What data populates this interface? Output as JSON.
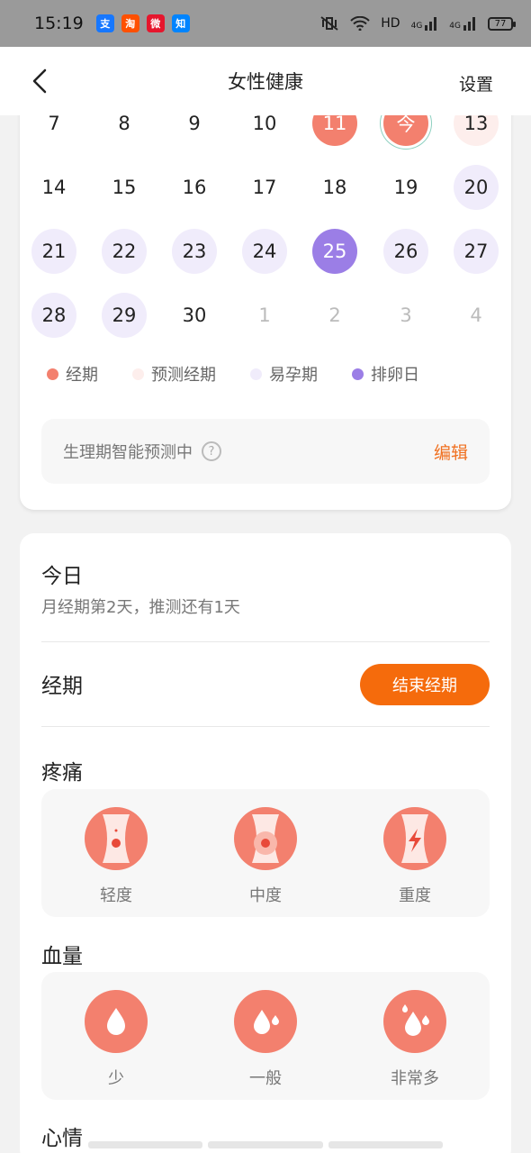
{
  "status": {
    "time": "15:19",
    "apps": [
      {
        "name": "alipay-icon",
        "glyph": "支",
        "color": "#1677ff"
      },
      {
        "name": "taobao-icon",
        "glyph": "淘",
        "color": "#ff5000"
      },
      {
        "name": "weibo-icon",
        "glyph": "微",
        "color": "#e6162d"
      },
      {
        "name": "zhihu-icon",
        "glyph": "知",
        "color": "#0084ff"
      }
    ],
    "network": "HD",
    "signal1": "4G",
    "signal2": "4G",
    "battery": "77"
  },
  "header": {
    "title": "女性健康",
    "settings_label": "设置"
  },
  "calendar": {
    "rows": [
      [
        {
          "d": "7",
          "t": ""
        },
        {
          "d": "8",
          "t": ""
        },
        {
          "d": "9",
          "t": ""
        },
        {
          "d": "10",
          "t": ""
        },
        {
          "d": "11",
          "t": "period"
        },
        {
          "d": "今",
          "t": "today"
        },
        {
          "d": "13",
          "t": "pred"
        }
      ],
      [
        {
          "d": "14",
          "t": ""
        },
        {
          "d": "15",
          "t": ""
        },
        {
          "d": "16",
          "t": ""
        },
        {
          "d": "17",
          "t": ""
        },
        {
          "d": "18",
          "t": ""
        },
        {
          "d": "19",
          "t": ""
        },
        {
          "d": "20",
          "t": "fertile"
        }
      ],
      [
        {
          "d": "21",
          "t": "fertile"
        },
        {
          "d": "22",
          "t": "fertile"
        },
        {
          "d": "23",
          "t": "fertile"
        },
        {
          "d": "24",
          "t": "fertile"
        },
        {
          "d": "25",
          "t": "ovu"
        },
        {
          "d": "26",
          "t": "fertile"
        },
        {
          "d": "27",
          "t": "fertile"
        }
      ],
      [
        {
          "d": "28",
          "t": "fertile"
        },
        {
          "d": "29",
          "t": "fertile"
        },
        {
          "d": "30",
          "t": ""
        },
        {
          "d": "1",
          "t": "next"
        },
        {
          "d": "2",
          "t": "next"
        },
        {
          "d": "3",
          "t": "next"
        },
        {
          "d": "4",
          "t": "next"
        }
      ]
    ],
    "legend": [
      {
        "label": "经期",
        "color": "#f3806e"
      },
      {
        "label": "预测经期",
        "color": "#fdeeec"
      },
      {
        "label": "易孕期",
        "color": "#f0ecfb"
      },
      {
        "label": "排卵日",
        "color": "#9b7ee6"
      }
    ],
    "predict_text": "生理期智能预测中",
    "predict_help": "?",
    "edit_label": "编辑"
  },
  "today": {
    "title": "今日",
    "subtitle": "月经期第2天，推测还有1天",
    "period_label": "经期",
    "end_button": "结束经期",
    "pain_label": "疼痛",
    "pain_options": [
      "轻度",
      "中度",
      "重度"
    ],
    "flow_label": "血量",
    "flow_options": [
      "少",
      "一般",
      "非常多"
    ],
    "mood_label": "心情"
  },
  "colors": {
    "accent": "#f3806e",
    "orange": "#f56b0c",
    "purple": "#9b7ee6",
    "fertile": "#f0ecfb",
    "predicted": "#fdeeec"
  }
}
